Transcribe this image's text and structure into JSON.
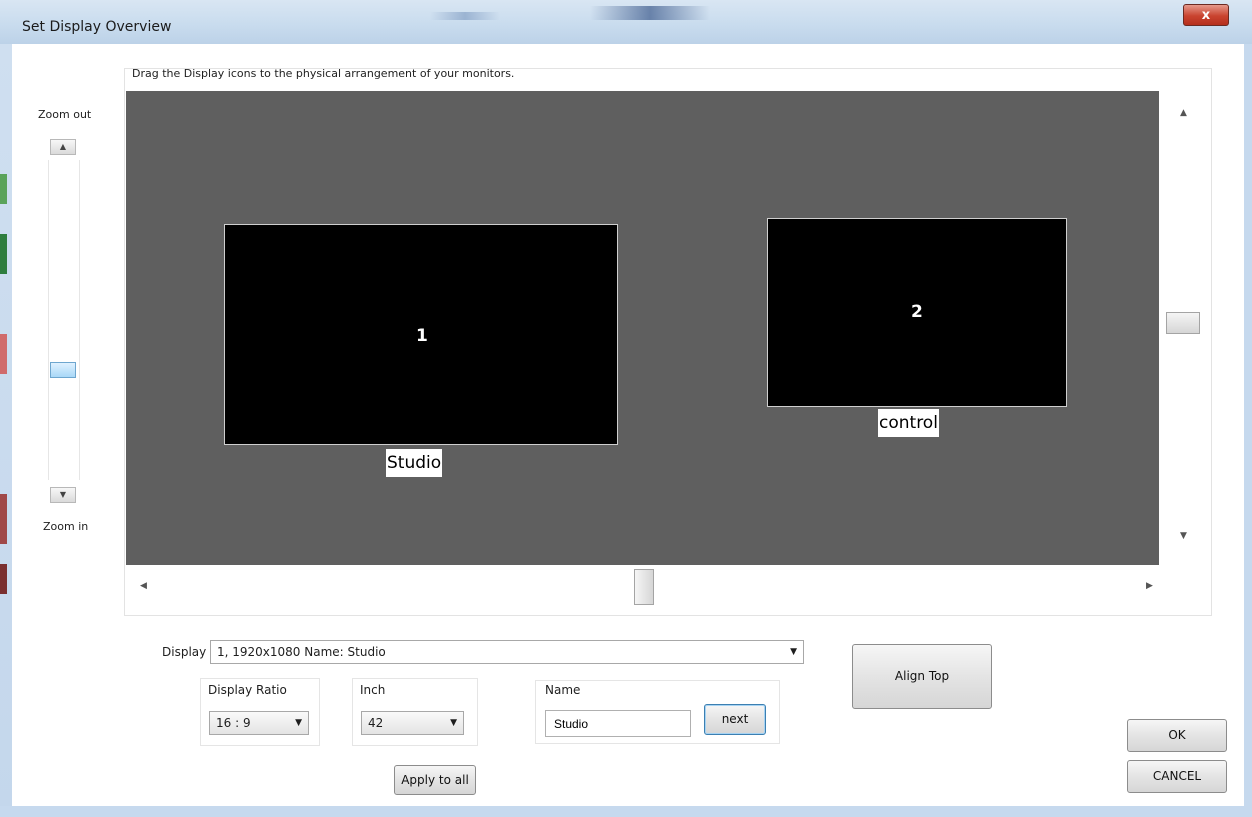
{
  "window": {
    "title": "Set Display Overview",
    "close_glyph": "x"
  },
  "instruction": "Drag the Display icons to the physical arrangement of your monitors.",
  "zoom": {
    "zoom_out_label": "Zoom out",
    "zoom_in_label": "Zoom in",
    "up_glyph": "▲",
    "down_glyph": "▼"
  },
  "canvas": {
    "background": "#5f5f5f",
    "displays": [
      {
        "number": "1",
        "name": "Studio"
      },
      {
        "number": "2",
        "name": "control"
      }
    ]
  },
  "scrollbars": {
    "up": "▲",
    "down": "▼",
    "left": "◀",
    "right": "▶"
  },
  "display_select": {
    "label": "Display :",
    "value": "1, 1920x1080 Name: Studio",
    "arrow": "▼"
  },
  "display_ratio": {
    "label": "Display Ratio",
    "value": "16 : 9",
    "arrow": "▼"
  },
  "inch": {
    "label": "Inch",
    "value": "42",
    "arrow": "▼"
  },
  "name_field": {
    "label": "Name",
    "value": "Studio"
  },
  "buttons": {
    "next": "next",
    "align_top": "Align Top",
    "apply_to_all": "Apply to all",
    "ok": "OK",
    "cancel": "CANCEL"
  }
}
